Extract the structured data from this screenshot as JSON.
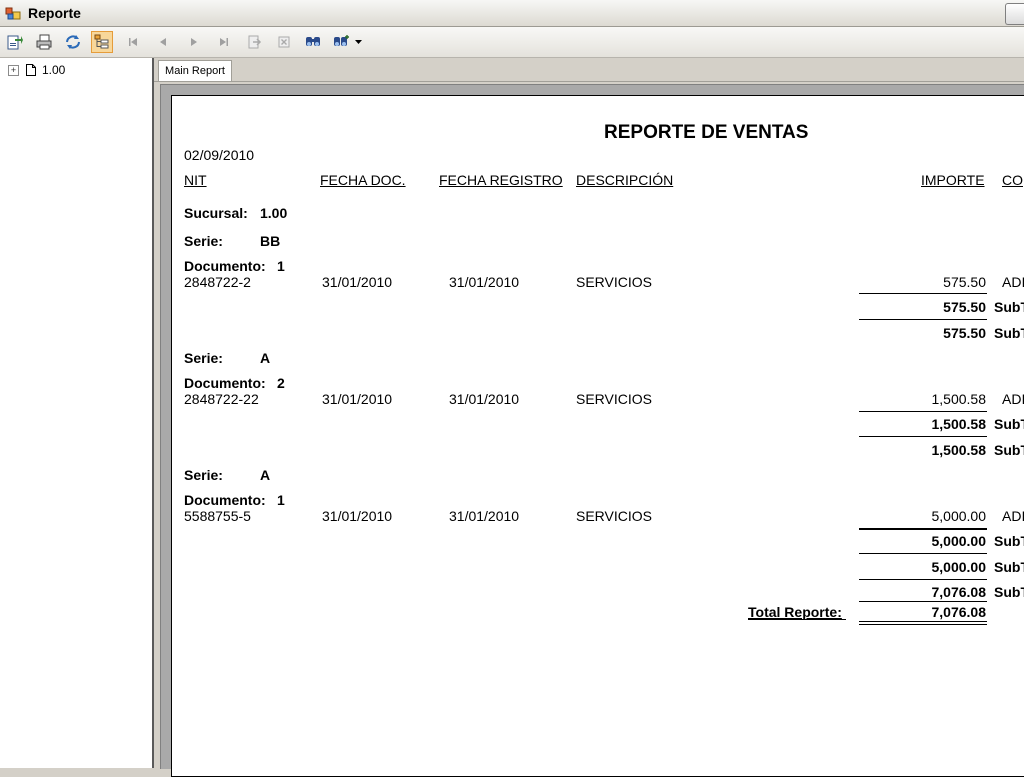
{
  "window": {
    "title": "Reporte"
  },
  "toolbar": {
    "buttons": [
      {
        "icon": "export-icon"
      },
      {
        "icon": "print-icon"
      },
      {
        "icon": "refresh-icon"
      },
      {
        "icon": "group-tree-icon"
      },
      {
        "icon": "first-page-icon"
      },
      {
        "icon": "previous-page-icon"
      },
      {
        "icon": "next-page-icon"
      },
      {
        "icon": "last-page-icon"
      },
      {
        "icon": "goto-page-icon"
      },
      {
        "icon": "stop-icon"
      },
      {
        "icon": "search-icon"
      },
      {
        "icon": "zoom-icon"
      }
    ]
  },
  "tree": {
    "nodes": [
      {
        "label": "1.00"
      }
    ]
  },
  "tabs": [
    {
      "label": "Main Report"
    }
  ],
  "report": {
    "title": "REPORTE DE VENTAS",
    "date": "02/09/2010",
    "columns": {
      "nit": "NIT",
      "fecha_doc": "FECHA DOC.",
      "fecha_registro": "FECHA REGISTRO",
      "descripcion": "DESCRIPCIÓN",
      "importe": "IMPORTE",
      "co": "CO"
    },
    "sucursal": {
      "label": "Sucursal:",
      "value": "1.00"
    },
    "serie_label": "Serie:",
    "documento_label": "Documento:",
    "groups": [
      {
        "serie": "BB",
        "documento": "1",
        "row": {
          "nit": "2848722-2",
          "fecha_doc": "31/01/2010",
          "fecha_registro": "31/01/2010",
          "descripcion": "SERVICIOS",
          "importe": "575.50",
          "extra": "ADI"
        },
        "subtotal1": "575.50",
        "subtotal2": "575.50"
      },
      {
        "serie": "A",
        "documento": "2",
        "row": {
          "nit": "2848722-22",
          "fecha_doc": "31/01/2010",
          "fecha_registro": "31/01/2010",
          "descripcion": "SERVICIOS",
          "importe": "1,500.58",
          "extra": "ADI"
        },
        "subtotal1": "1,500.58",
        "subtotal2": "1,500.58"
      },
      {
        "serie": "A",
        "documento": "1",
        "row": {
          "nit": "5588755-5",
          "fecha_doc": "31/01/2010",
          "fecha_registro": "31/01/2010",
          "descripcion": "SERVICIOS",
          "importe": "5,000.00",
          "extra": "ADI"
        },
        "subtotal1": "5,000.00",
        "subtotal2": "5,000.00"
      }
    ],
    "subtot_label": "SubT",
    "sucursal_subtotal": "7,076.08",
    "total_label": "Total Reporte:",
    "total_value": "7,076.08"
  }
}
